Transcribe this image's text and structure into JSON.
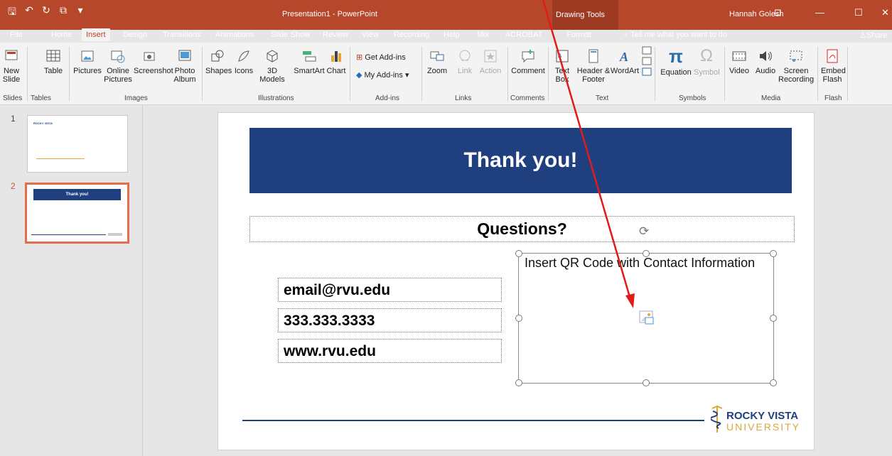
{
  "titlebar": {
    "title": "Presentation1  -  PowerPoint",
    "drawing_tools": "Drawing Tools",
    "user": "Hannah Golesh"
  },
  "tabs": [
    "File",
    "Home",
    "Insert",
    "Design",
    "Transitions",
    "Animations",
    "Slide Show",
    "Review",
    "View",
    "Recording",
    "Help",
    "Mix",
    "ACROBAT",
    "Format"
  ],
  "active_tab": "Insert",
  "tell_me": "Tell me what you want to do",
  "share": "Share",
  "ribbon": {
    "new_slide": "New Slide",
    "table": "Table",
    "pictures": "Pictures",
    "online_pictures": "Online Pictures",
    "screenshot": "Screenshot",
    "photo_album": "Photo Album",
    "shapes": "Shapes",
    "icons": "Icons",
    "models_3d": "3D Models",
    "smartart": "SmartArt",
    "chart": "Chart",
    "get_addins": "Get Add-ins",
    "my_addins": "My Add-ins",
    "zoom": "Zoom",
    "link": "Link",
    "action": "Action",
    "comment": "Comment",
    "text_box": "Text Box",
    "header_footer": "Header & Footer",
    "wordart": "WordArt",
    "equation": "Equation",
    "symbol": "Symbol",
    "video": "Video",
    "audio": "Audio",
    "screen_recording": "Screen Recording",
    "embed_flash": "Embed Flash",
    "groups": {
      "slides": "Slides",
      "tables": "Tables",
      "images": "Images",
      "illustrations": "Illustrations",
      "addins": "Add-ins",
      "links": "Links",
      "comments": "Comments",
      "text": "Text",
      "symbols": "Symbols",
      "media": "Media",
      "flash": "Flash"
    }
  },
  "thumbnails": {
    "slide1_num": "1",
    "slide2_num": "2",
    "slide1_logo": "ROCKY VISTA",
    "slide2_title": "Thank you!"
  },
  "slide": {
    "title": "Thank you!",
    "questions": "Questions?",
    "email": "email@rvu.edu",
    "phone": "333.333.3333",
    "website": "www.rvu.edu",
    "qr_placeholder": "Insert QR Code with Contact Information",
    "logo_name": "ROCKY VISTA",
    "logo_sub": "UNIVERSITY"
  },
  "colors": {
    "accent": "#b7472a",
    "banner": "#1f3f7f",
    "arrow": "#e31a1a",
    "logo_gold": "#d9a93c"
  }
}
